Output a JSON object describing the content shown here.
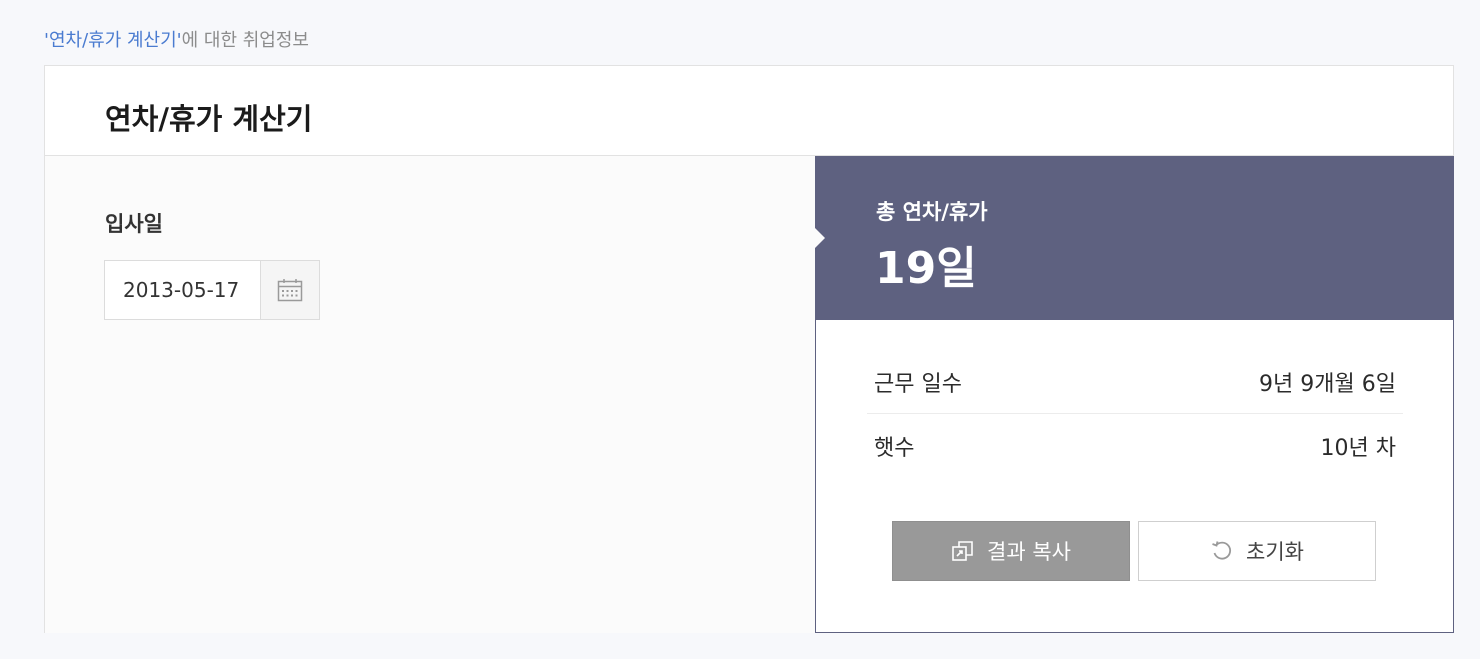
{
  "breadcrumb": {
    "keyword": "'연차/휴가 계산기'",
    "suffix": "에 대한 취업정보"
  },
  "card": {
    "title": "연차/휴가 계산기"
  },
  "form": {
    "hire_date_label": "입사일",
    "hire_date_value": "2013-05-17",
    "calendar_icon": "calendar-icon"
  },
  "result": {
    "total_label": "총 연차/휴가",
    "total_value": "19일",
    "rows": [
      {
        "label": "근무 일수",
        "value": "9년 9개월 6일"
      },
      {
        "label": "햇수",
        "value": "10년 차"
      }
    ],
    "copy_button": "결과 복사",
    "reset_button": "초기화",
    "copy_icon": "copy-icon",
    "reset_icon": "reset-icon"
  },
  "colors": {
    "accent": "#5e6180",
    "keyword": "#4a7bd0",
    "copy_button_bg": "#999999"
  }
}
